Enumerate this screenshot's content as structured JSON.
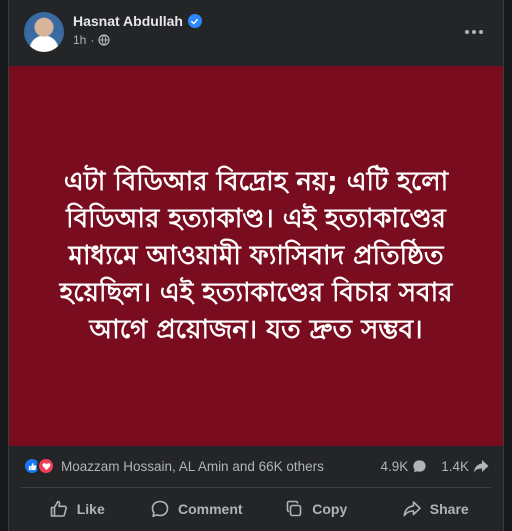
{
  "post": {
    "author": "Hasnat Abdullah",
    "time": "1h",
    "separator": "·",
    "text": "এটা বিডিআর বিদ্রোহ নয়; এটি হলো বিডিআর হত্যাকাণ্ড। এই হত্যাকাণ্ডের মাধ্যমে আওয়ামী ফ্যাসিবাদ প্রতিষ্ঠিত হয়েছিল। এই হত্যাকাণ্ডের বিচার সবার আগে প্রয়োজন। যত দ্রুত সম্ভব।",
    "background_color": "#7a0c20"
  },
  "reactions": {
    "reactors_text": "Moazzam Hossain, AL Amin and 66K others",
    "comment_count": "4.9K",
    "share_count": "1.4K"
  },
  "actions": {
    "like": "Like",
    "comment": "Comment",
    "copy": "Copy",
    "share": "Share"
  },
  "icons": [
    "verified-badge-icon",
    "globe-icon",
    "more-icon",
    "like-reaction-icon",
    "love-reaction-icon",
    "comment-bubble-icon",
    "share-arrow-icon",
    "like-icon",
    "comment-icon",
    "copy-icon",
    "share-icon"
  ]
}
